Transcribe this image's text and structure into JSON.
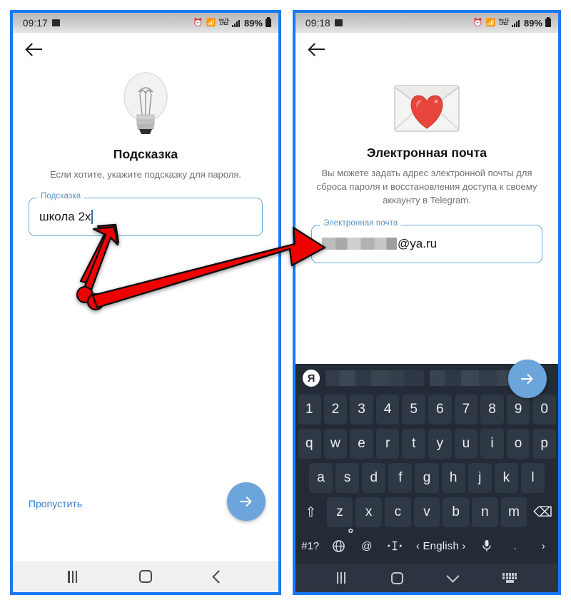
{
  "screens": [
    {
      "id": "hint-screen",
      "statusbar": {
        "time": "09:17",
        "battery": "89%",
        "network_label_top": "VoLTE",
        "network_label_bottom": "LTE2"
      },
      "back_label": "Back",
      "hero_icon": "light-bulb-emoji",
      "title": "Подсказка",
      "subtitle": "Если хотите, укажите подсказку для пароля.",
      "field": {
        "label": "Подсказка",
        "value": "школа 2x",
        "redacted": false
      },
      "skip_label": "Пропустить",
      "fab_icon": "arrow-right-icon",
      "navbar": [
        "recents-icon",
        "home-icon",
        "back-icon"
      ]
    },
    {
      "id": "email-screen",
      "statusbar": {
        "time": "09:18",
        "battery": "89%",
        "network_label_top": "VoLTE",
        "network_label_bottom": "LTE2"
      },
      "back_label": "Back",
      "hero_icon": "love-letter-emoji",
      "title": "Электронная почта",
      "subtitle": "Вы можете задать адрес электронной почты для сброса пароля и восстановления доступа к своему аккаунту в Telegram.",
      "field": {
        "label": "Электронная почта",
        "value": "@ya.ru",
        "redacted": true
      },
      "fab_icon": "arrow-right-icon",
      "navbar": [
        "recents-icon",
        "home-icon",
        "hide-keyboard-icon",
        "keyboard-switch-icon"
      ]
    }
  ],
  "keyboard": {
    "yandex_logo": "Я",
    "emoji_key": "☺",
    "suggestions": [
      "",
      ""
    ],
    "rows": {
      "numbers": [
        "1",
        "2",
        "3",
        "4",
        "5",
        "6",
        "7",
        "8",
        "9",
        "0"
      ],
      "top": [
        "q",
        "w",
        "e",
        "r",
        "t",
        "y",
        "u",
        "i",
        "o",
        "p"
      ],
      "middle": [
        "a",
        "s",
        "d",
        "f",
        "g",
        "h",
        "j",
        "k",
        "l"
      ],
      "bottom": [
        "z",
        "x",
        "c",
        "v",
        "b",
        "n",
        "m"
      ]
    },
    "shift_key": "⇧",
    "backspace_key": "⌫",
    "symbols_key": "#1?",
    "globe_key": "globe-icon",
    "at_key": "@",
    "cursor_key": "cursor-control-icon",
    "language_key": "‹ English ›",
    "mic_key": "mic-icon",
    "period_key": ".",
    "enter_key": "›"
  },
  "colors": {
    "frame_blue": "#1879f0",
    "fab_blue": "#6ca4dc",
    "field_border": "#69a8d8",
    "field_label": "#5a93c4",
    "link_blue": "#3a7fc4",
    "keyboard_bg": "#222b36",
    "key_bg": "#2e3945",
    "annotation_red": "#ef0000"
  },
  "annotations": [
    {
      "name": "arrow-to-hint-field",
      "description": "red arrow pointing up-left to hint input"
    },
    {
      "name": "arrow-to-email-field",
      "description": "red arrow pointing right to email input"
    }
  ]
}
